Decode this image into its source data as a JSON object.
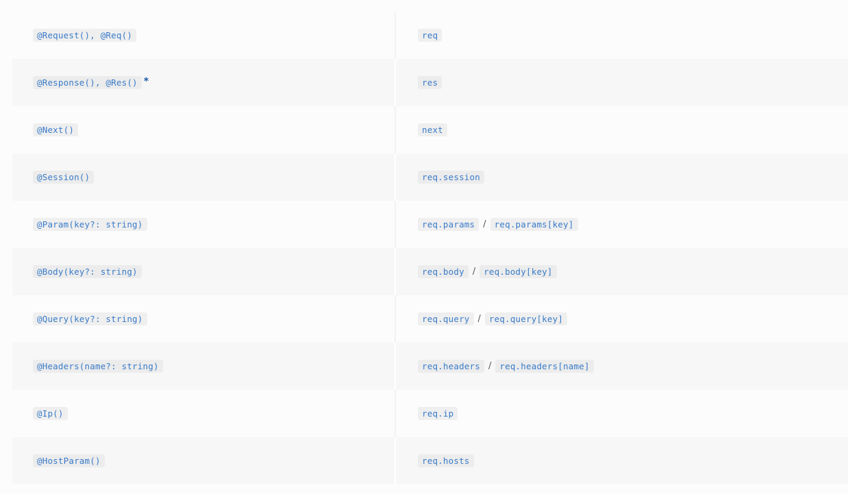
{
  "rows": [
    {
      "decorator": "@Request(), @Req()",
      "mark": "",
      "equivalents": [
        "req"
      ]
    },
    {
      "decorator": "@Response(), @Res()",
      "mark": "*",
      "equivalents": [
        "res"
      ]
    },
    {
      "decorator": "@Next()",
      "mark": "",
      "equivalents": [
        "next"
      ]
    },
    {
      "decorator": "@Session()",
      "mark": "",
      "equivalents": [
        "req.session"
      ]
    },
    {
      "decorator": "@Param(key?: string)",
      "mark": "",
      "equivalents": [
        "req.params",
        "req.params[key]"
      ]
    },
    {
      "decorator": "@Body(key?: string)",
      "mark": "",
      "equivalents": [
        "req.body",
        "req.body[key]"
      ]
    },
    {
      "decorator": "@Query(key?: string)",
      "mark": "",
      "equivalents": [
        "req.query",
        "req.query[key]"
      ]
    },
    {
      "decorator": "@Headers(name?: string)",
      "mark": "",
      "equivalents": [
        "req.headers",
        "req.headers[name]"
      ]
    },
    {
      "decorator": "@Ip()",
      "mark": "",
      "equivalents": [
        "req.ip"
      ]
    },
    {
      "decorator": "@HostParam()",
      "mark": "",
      "equivalents": [
        "req.hosts"
      ]
    }
  ],
  "separator": "/"
}
